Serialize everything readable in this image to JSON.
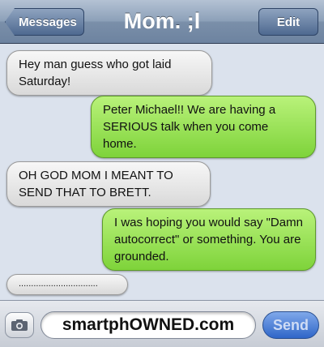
{
  "header": {
    "back_label": "Messages",
    "title": "Mom. ;l",
    "edit_label": "Edit"
  },
  "messages": [
    {
      "direction": "received",
      "text": "Hey man guess who got laid Saturday!"
    },
    {
      "direction": "sent",
      "text": "Peter Michael!! We are having a SERIOUS talk when you come home."
    },
    {
      "direction": "received",
      "text": "OH GOD MOM I MEANT TO SEND THAT TO BRETT."
    },
    {
      "direction": "sent",
      "text": "I was hoping you would say \"Damn autocorrect\" or something. You are grounded."
    },
    {
      "direction": "received",
      "text": "................................"
    }
  ],
  "composer": {
    "field_value": "smartphOWNED.com",
    "send_label": "Send",
    "camera_icon": "camera-icon"
  },
  "colors": {
    "sent_bubble": "#8ed84a",
    "received_bubble": "#e8e8e8",
    "navbar": "#8da1b9",
    "send_button": "#3f74d2"
  }
}
